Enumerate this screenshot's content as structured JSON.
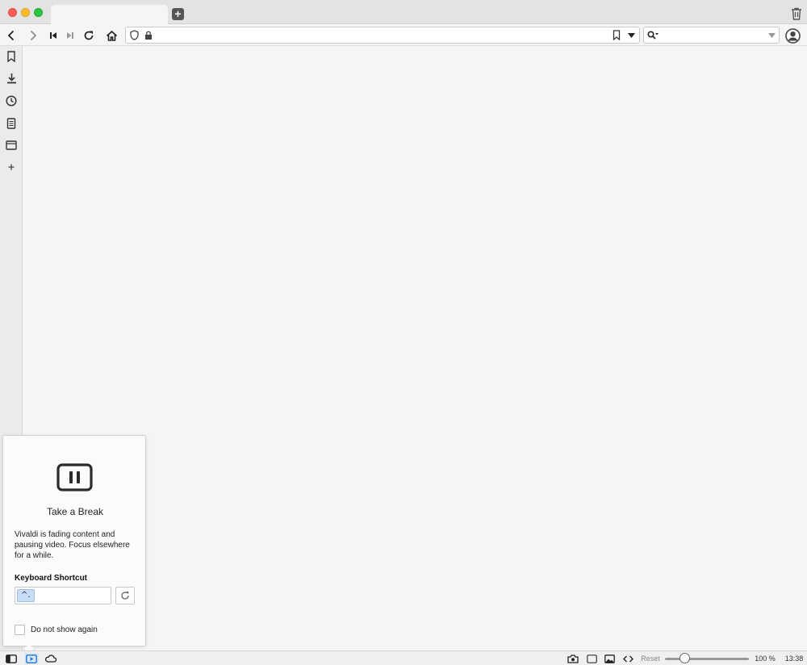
{
  "window": {
    "tab_title": "",
    "new_tab_symbol": "+"
  },
  "toolbar": {
    "address_value": "",
    "search_value": ""
  },
  "popup": {
    "title": "Take a Break",
    "description": "Vivaldi is fading content and pausing video. Focus elsewhere for a while.",
    "shortcut_label": "Keyboard Shortcut",
    "shortcut_value": "^.",
    "checkbox_label": "Do not show again"
  },
  "statusbar": {
    "reset_label": "Reset",
    "zoom": "100 %",
    "clock": "13:38",
    "zoom_level_fraction": 0.2
  },
  "colors": {
    "accent": "#2b7fd6",
    "close": "#fe5f57",
    "minimize": "#febc2e",
    "maximize": "#28c840"
  },
  "icons": {
    "sidebar": [
      "bookmark-icon",
      "download-icon",
      "history-icon",
      "notes-icon",
      "window-icon",
      "add-panel-icon"
    ],
    "statusbar": [
      "panel-toggle-icon",
      "break-mode-icon",
      "sync-cloud-icon",
      "capture-icon",
      "tiling-icon",
      "images-icon",
      "page-actions-icon"
    ]
  }
}
